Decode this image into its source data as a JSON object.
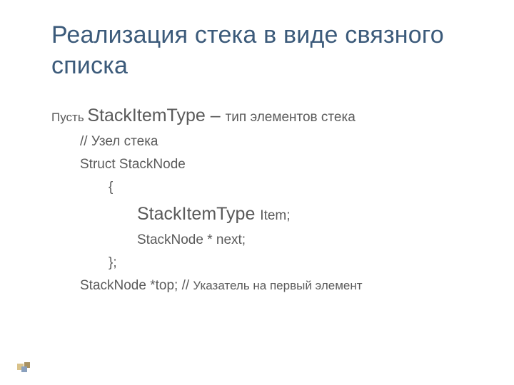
{
  "title": "Реализация стека в виде связного списка",
  "intro": {
    "prefix": "Пусть ",
    "type": "StackItemType",
    "dash": " – ",
    "suffix": "тип элементов стека"
  },
  "code": {
    "comment_node": "// Узел стека",
    "struct_decl": "Struct StackNode",
    "brace_open": "{",
    "field_type_type": "StackItemType ",
    "field_type_name": "Item;",
    "field_next": "StackNode * next;",
    "brace_close": "};",
    "top_decl": "StackNode *top; // ",
    "top_comment": "Указатель на первый элемент"
  }
}
